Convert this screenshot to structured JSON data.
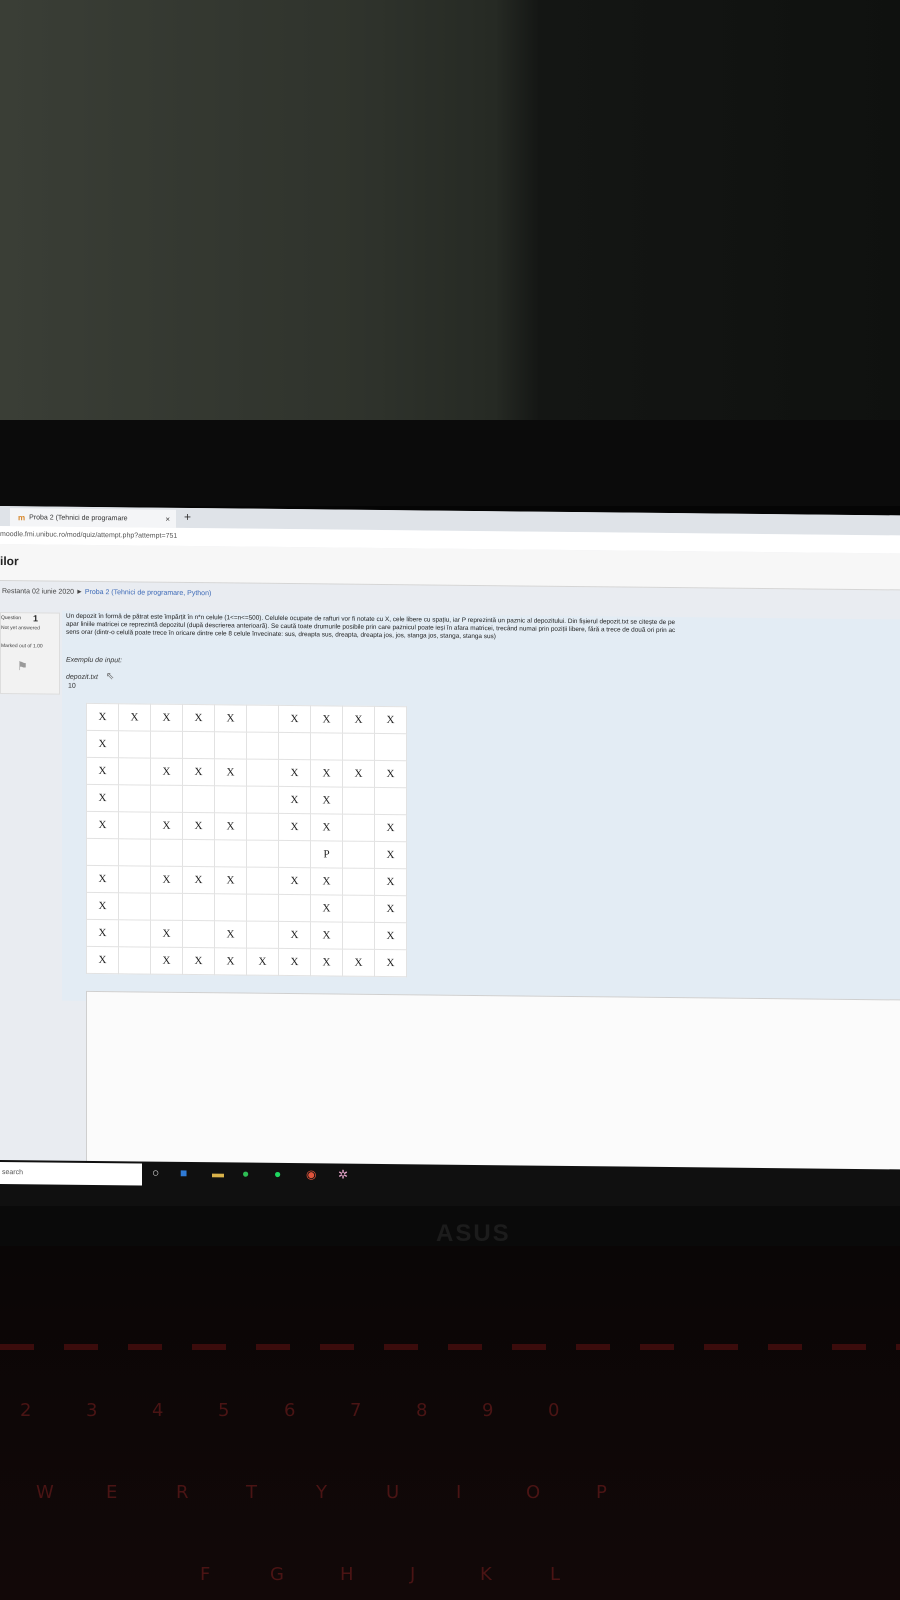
{
  "browser": {
    "tab_title": "Proba 2 (Tehnici de programare",
    "tab_close": "×",
    "new_tab": "+",
    "url": "moodle.fmi.unibuc.ro/mod/quiz/attempt.php?attempt=751"
  },
  "site": {
    "title": "ilor"
  },
  "breadcrumb": {
    "root": "Restanta 02 iunie 2020",
    "separator": "►",
    "current": "Proba 2 (Tehnici de programare, Python)"
  },
  "question": {
    "label": "Question",
    "number": "1",
    "status": "Not yet answered",
    "marked": "Marked out of 1.00",
    "text_line1": "Un depozit în formă de pătrat este împărțit în n*n celule (1<=n<=500). Celulele ocupate de rafturi vor fi notate cu X, cele libere cu spațiu, iar P reprezintă un paznic al depozitului. Din fișierul depozit.txt se citește de pe",
    "text_line2": "apar liniile matricei ce reprezintă depozitul (după descrierea anterioară). Se caută toate drumurile posibile prin care paznicul poate ieși în afara matricei, trecând numai prin poziții libere, fără a trece de două ori prin ac",
    "text_line3": "sens orar (dintr-o celulă poate trece în oricare dintre cele 8 celule învecinate: sus, dreapta sus, dreapta, dreapta jos, jos, stanga jos, stanga, stanga sus)",
    "example_label": "Exemplu de input:",
    "file_label": "depozit.txt",
    "n_value": "10",
    "grid": [
      [
        "X",
        "X",
        "X",
        "X",
        "X",
        "",
        "X",
        "X",
        "X",
        "X"
      ],
      [
        "X",
        "",
        "",
        "",
        "",
        "",
        "",
        "",
        "",
        ""
      ],
      [
        "X",
        "",
        "X",
        "X",
        "X",
        "",
        "X",
        "X",
        "X",
        "X"
      ],
      [
        "X",
        "",
        "",
        "",
        "",
        "",
        "X",
        "X",
        "",
        ""
      ],
      [
        "X",
        "",
        "X",
        "X",
        "X",
        "",
        "X",
        "X",
        "",
        "X"
      ],
      [
        "",
        "",
        "",
        "",
        "",
        "",
        "",
        "P",
        "",
        "X"
      ],
      [
        "X",
        "",
        "X",
        "X",
        "X",
        "",
        "X",
        "X",
        "",
        "X"
      ],
      [
        "X",
        "",
        "",
        "",
        "",
        "",
        "",
        "X",
        "",
        "X"
      ],
      [
        "X",
        "",
        "X",
        "",
        "X",
        "",
        "X",
        "X",
        "",
        "X"
      ],
      [
        "X",
        "",
        "X",
        "X",
        "X",
        "X",
        "X",
        "X",
        "X",
        "X"
      ]
    ]
  },
  "taskbar": {
    "search_placeholder": "search"
  },
  "laptop": {
    "brand": "ASUS",
    "keys": [
      "2",
      "3",
      "4",
      "5",
      "6",
      "7",
      "8",
      "9",
      "0",
      "W",
      "E",
      "R",
      "T",
      "Y",
      "U",
      "I",
      "O",
      "P",
      "F",
      "G",
      "H",
      "J",
      "K",
      "L"
    ]
  }
}
